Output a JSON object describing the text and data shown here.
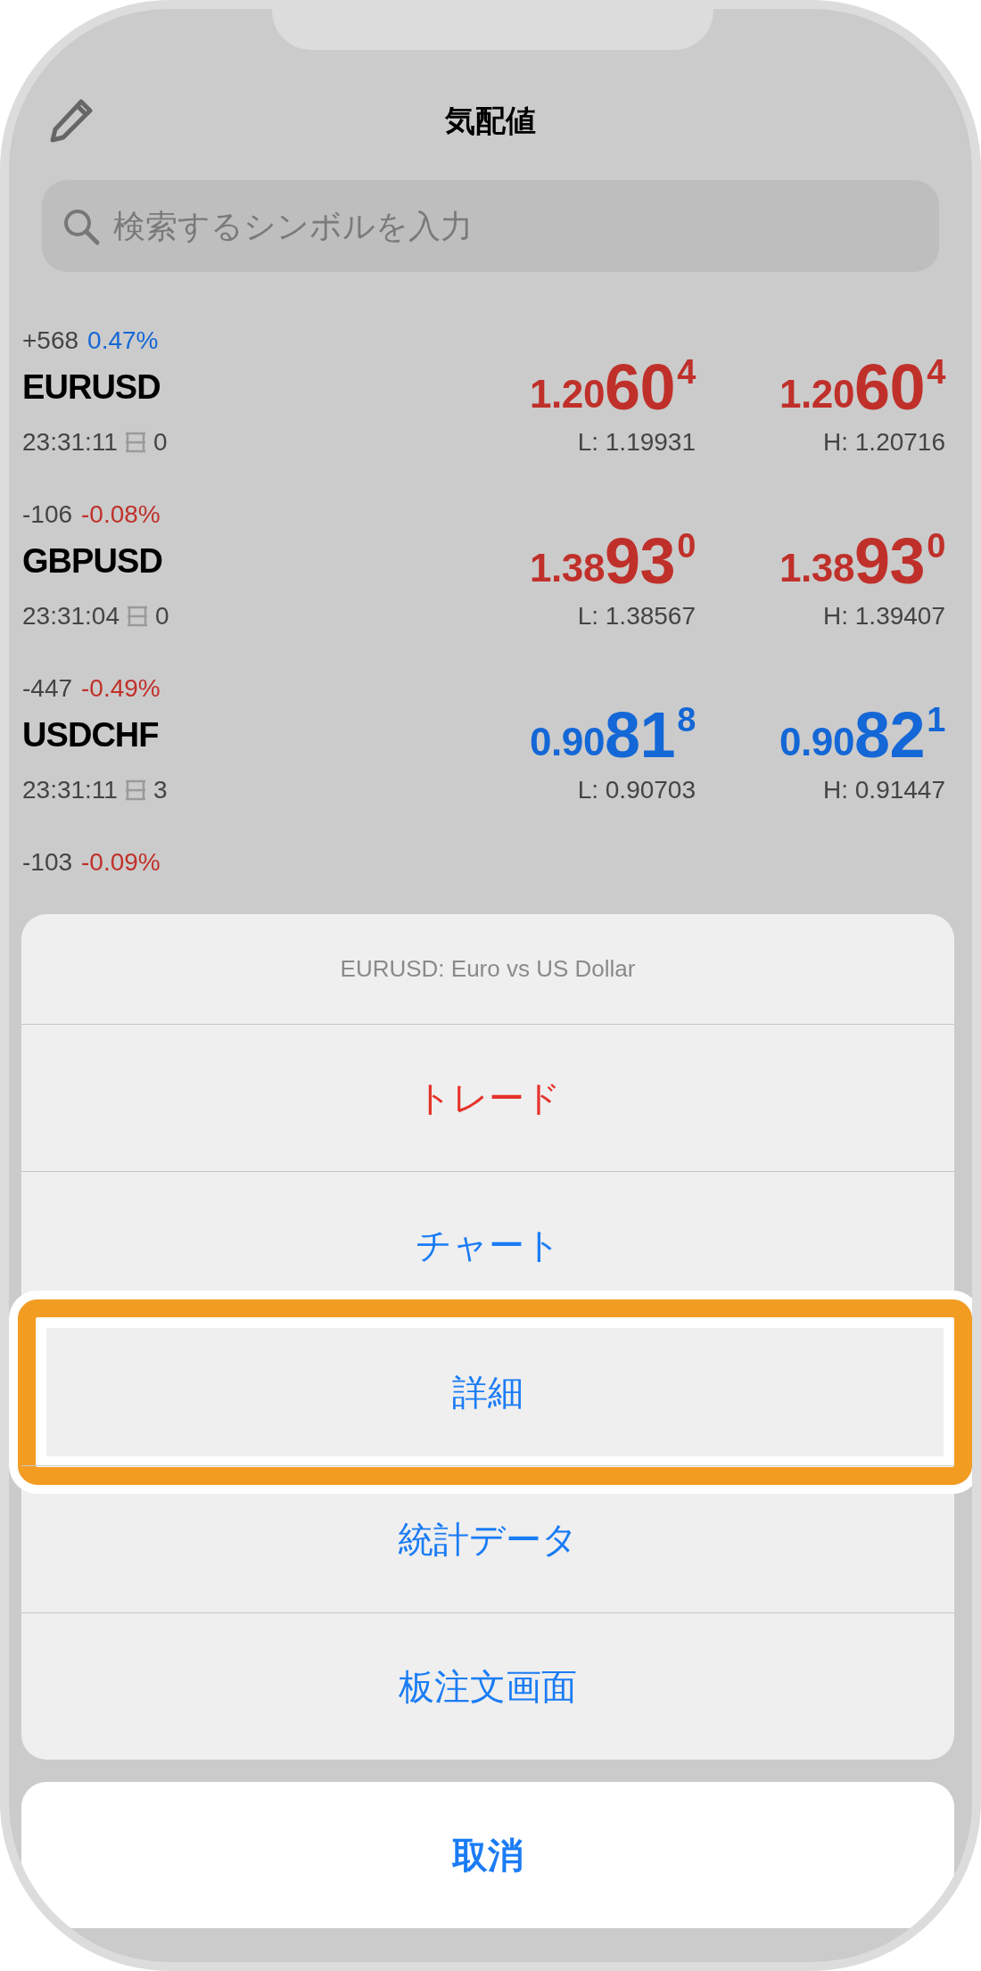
{
  "header": {
    "title": "気配値"
  },
  "search": {
    "placeholder": "検索するシンボルを入力"
  },
  "quotes": [
    {
      "points": "+568",
      "percent": {
        "text": "0.47%",
        "color": "#1467d6"
      },
      "symbol": "EURUSD",
      "time": "23:31:11",
      "spread": "0",
      "bid": {
        "prefix": "1.20",
        "big": "60",
        "sup": "4",
        "color": "#c0302a"
      },
      "ask": {
        "prefix": "1.20",
        "big": "60",
        "sup": "4",
        "color": "#c0302a"
      },
      "low": "L: 1.19931",
      "high": "H: 1.20716"
    },
    {
      "points": "-106",
      "percent": {
        "text": "-0.08%",
        "color": "#c0302a"
      },
      "symbol": "GBPUSD",
      "time": "23:31:04",
      "spread": "0",
      "bid": {
        "prefix": "1.38",
        "big": "93",
        "sup": "0",
        "color": "#c0302a"
      },
      "ask": {
        "prefix": "1.38",
        "big": "93",
        "sup": "0",
        "color": "#c0302a"
      },
      "low": "L: 1.38567",
      "high": "H: 1.39407"
    },
    {
      "points": "-447",
      "percent": {
        "text": "-0.49%",
        "color": "#c0302a"
      },
      "symbol": "USDCHF",
      "time": "23:31:11",
      "spread": "3",
      "bid": {
        "prefix": "0.90",
        "big": "81",
        "sup": "8",
        "color": "#1467d6"
      },
      "ask": {
        "prefix": "0.90",
        "big": "82",
        "sup": "1",
        "color": "#1467d6"
      },
      "low": "L: 0.90703",
      "high": "H: 0.91447"
    },
    {
      "points": "-103",
      "percent": {
        "text": "-0.09%",
        "color": "#c0302a"
      }
    }
  ],
  "action_sheet": {
    "title": "EURUSD: Euro vs US Dollar",
    "items": [
      {
        "label": "トレード",
        "kind": "destructive",
        "highlighted": false
      },
      {
        "label": "チャート",
        "kind": "default",
        "highlighted": false
      },
      {
        "label": "詳細",
        "kind": "default",
        "highlighted": true
      },
      {
        "label": "統計データ",
        "kind": "default",
        "highlighted": false
      },
      {
        "label": "板注文画面",
        "kind": "default",
        "highlighted": false
      }
    ],
    "cancel": "取消"
  }
}
